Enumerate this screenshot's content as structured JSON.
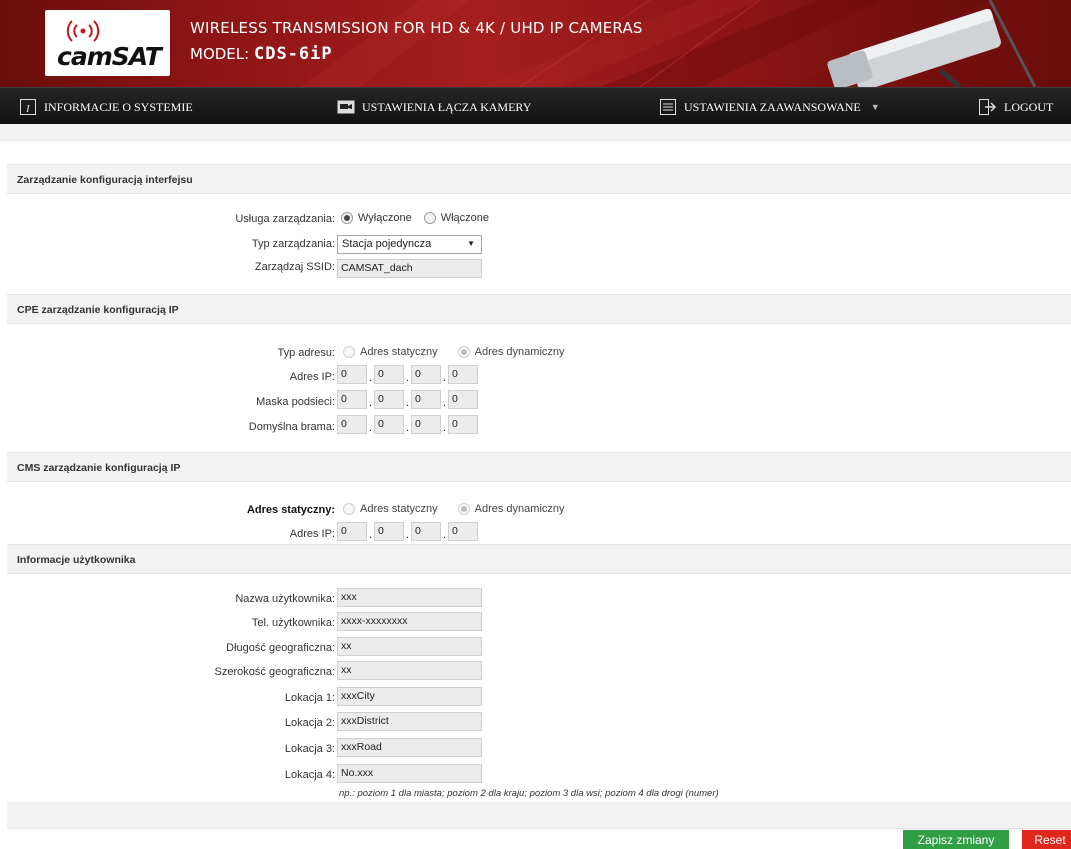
{
  "header": {
    "logo_text": "camSAT",
    "title": "WIRELESS TRANSMISSION FOR HD & 4K / UHD IP CAMERAS",
    "model_label": "MODEL:",
    "model_value": "CDS-6iP"
  },
  "nav": {
    "system_info": "INFORMACJE O SYSTEMIE",
    "camera_link": "USTAWIENIA ŁĄCZA KAMERY",
    "advanced": "USTAWIENIA ZAAWANSOWANE",
    "logout": "LOGOUT"
  },
  "interface_mgmt": {
    "title": "Zarządzanie konfiguracją interfejsu",
    "service_label": "Usługa zarządzania:",
    "service_off": "Wyłączone",
    "service_on": "Włączone",
    "service_selected": "Wyłączone",
    "type_label": "Typ zarządzania:",
    "type_value": "Stacja pojedyncza",
    "ssid_label": "Zarządzaj SSID:",
    "ssid_value": "CAMSAT_dach"
  },
  "cpe": {
    "title": "CPE zarządzanie konfiguracją IP",
    "addr_type_label": "Typ adresu:",
    "static": "Adres statyczny",
    "dynamic": "Adres dynamiczny",
    "selected": "Adres dynamiczny",
    "ip_label": "Adres IP:",
    "ip": [
      "0",
      "0",
      "0",
      "0"
    ],
    "mask_label": "Maska podsieci:",
    "mask": [
      "0",
      "0",
      "0",
      "0"
    ],
    "gateway_label": "Domyślna brama:",
    "gateway": [
      "0",
      "0",
      "0",
      "0"
    ]
  },
  "cms": {
    "title": "CMS zarządzanie konfiguracją IP",
    "addr_type_label": "Adres statyczny:",
    "static": "Adres statyczny",
    "dynamic": "Adres dynamiczny",
    "selected": "Adres dynamiczny",
    "ip_label": "Adres IP:",
    "ip": [
      "0",
      "0",
      "0",
      "0"
    ]
  },
  "user_info": {
    "title": "Informacje użytkownika",
    "name_label": "Nazwa użytkownika:",
    "name_value": "xxx",
    "phone_label": "Tel. użytkownika:",
    "phone_value": "xxxx-xxxxxxxx",
    "lon_label": "Długość geograficzna:",
    "lon_value": "xx",
    "lat_label": "Szerokość geograficzna:",
    "lat_value": "xx",
    "loc1_label": "Lokacja 1:",
    "loc1_value": "xxxCity",
    "loc2_label": "Lokacja 2:",
    "loc2_value": "xxxDistrict",
    "loc3_label": "Lokacja 3:",
    "loc3_value": "xxxRoad",
    "loc4_label": "Lokacja 4:",
    "loc4_value": "No.xxx",
    "hint": "np.: poziom 1 dla miasta; poziom 2 dla kraju; poziom 3 dla wsi; poziom 4 dla drogi (numer)"
  },
  "buttons": {
    "save": "Zapisz zmiany",
    "reset": "Reset"
  }
}
